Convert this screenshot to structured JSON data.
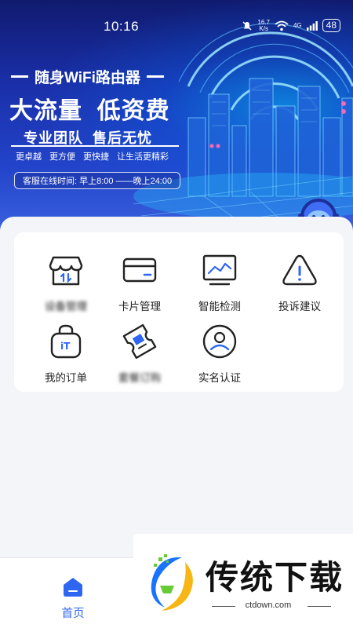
{
  "status_bar": {
    "time": "10:16",
    "network_speed_value": "16.7",
    "network_speed_unit": "K/s",
    "network_type": "4G",
    "battery": "48"
  },
  "banner": {
    "headline_1": "随身WiFi路由器",
    "headline_2": "大流量  低资费",
    "headline_3": "专业团队  售后无忧",
    "features": [
      "更卓越",
      "更方便",
      "更快捷",
      "让生活更精彩"
    ],
    "service_hours": "客服在线时间: 早上8:00 ——晚上24:00"
  },
  "menu": {
    "items": [
      {
        "label": "设备管理",
        "icon": "store-icon",
        "blurred": true
      },
      {
        "label": "卡片管理",
        "icon": "card-icon"
      },
      {
        "label": "智能检测",
        "icon": "monitor-chart-icon"
      },
      {
        "label": "投诉建议",
        "icon": "warning-icon"
      },
      {
        "label": "我的订单",
        "icon": "order-bag-icon"
      },
      {
        "label": "套餐订购",
        "icon": "ticket-icon",
        "blurred": true
      },
      {
        "label": "实名认证",
        "icon": "user-verify-icon"
      }
    ]
  },
  "tabbar": {
    "home_label": "首页"
  },
  "watermark": {
    "text": "传统下载",
    "url": "ctdown.com"
  },
  "colors": {
    "accent": "#2e66f2",
    "banner_dark": "#101a6e",
    "banner_light": "#3a63e0",
    "icon_stroke": "#222222",
    "icon_accent": "#2e66f2"
  }
}
